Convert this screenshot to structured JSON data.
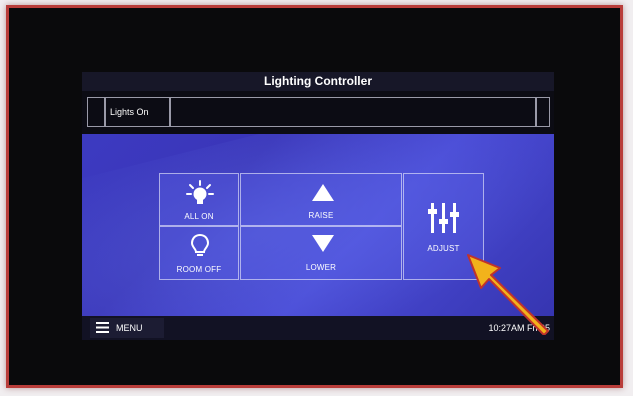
{
  "panel": {
    "title": "Lighting Controller",
    "status_label": "Lights On"
  },
  "buttons": {
    "all_on": "ALL ON",
    "room_off": "ROOM OFF",
    "raise": "RAISE",
    "lower": "LOWER",
    "adjust": "ADJUST"
  },
  "bottom": {
    "menu_label": "MENU",
    "clock": "10:27AM Fri 05"
  },
  "colors": {
    "screen_accent": "#3d3cc4",
    "frame_border": "#b93d3a",
    "arrow_fill": "#f2b21b",
    "arrow_stroke": "#c0332c"
  },
  "icons": {
    "all_on": "lightbulb-on-icon",
    "room_off": "lightbulb-off-icon",
    "raise": "triangle-up-icon",
    "lower": "triangle-down-icon",
    "adjust": "sliders-icon",
    "menu": "hamburger-icon"
  }
}
